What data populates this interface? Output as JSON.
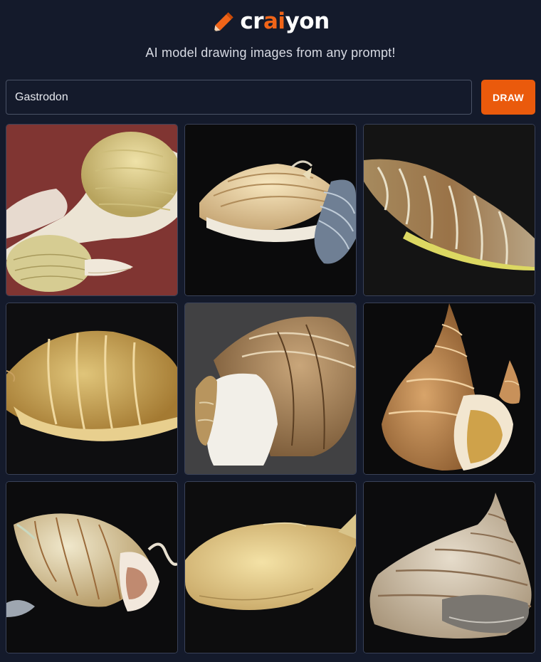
{
  "header": {
    "logo": {
      "part1": "cr",
      "accent": "ai",
      "part2": "yon",
      "icon": "pencil-icon",
      "accent_color": "#f06418"
    },
    "tagline": "AI model drawing images from any prompt!"
  },
  "prompt": {
    "value": "Gastrodon"
  },
  "draw_button": {
    "label": "DRAW",
    "color": "#ea5a0c"
  },
  "results": {
    "images": [
      {
        "subject": "two pale yellow snail shells on red surface"
      },
      {
        "subject": "cream snail with ribbed fins on black"
      },
      {
        "subject": "elongated brown banded shell on black"
      },
      {
        "subject": "oval tan striped shell on black"
      },
      {
        "subject": "brown striped shell with white body on grey sand"
      },
      {
        "subject": "conical brown spiral shell on black"
      },
      {
        "subject": "cream snail with brown stripes on black"
      },
      {
        "subject": "smooth yellow shell on black"
      },
      {
        "subject": "pale conical shell with grey bands on black"
      }
    ]
  }
}
